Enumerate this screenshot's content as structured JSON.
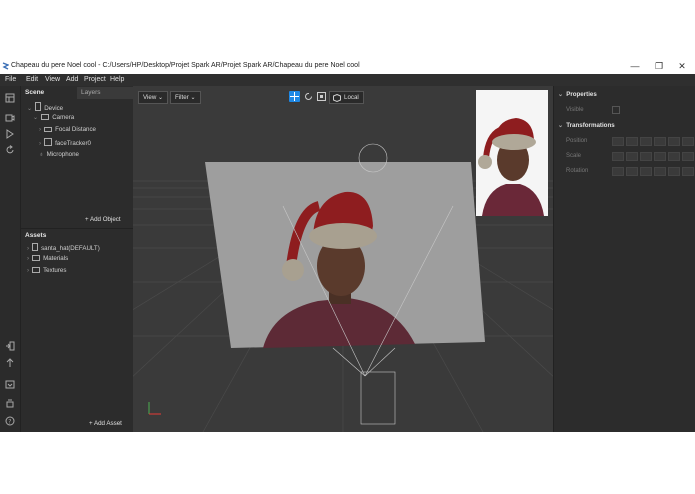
{
  "window": {
    "title": "Chapeau du pere Noel cool - C:/Users/HP/Desktop/Projet Spark AR/Projet Spark AR/Chapeau du pere Noel cool",
    "minimize": "—",
    "restore": "❐",
    "close": "✕"
  },
  "menu": [
    "File",
    "Edit",
    "View",
    "Add",
    "Project",
    "Help"
  ],
  "scene": {
    "tab_scene": "Scene",
    "tab_layers": "Layers",
    "items": [
      "Device",
      "Camera",
      "Focal Distance",
      "faceTracker0",
      "Microphone"
    ],
    "add_label": "+ Add Object"
  },
  "assets": {
    "header": "Assets",
    "items": [
      "santa_hat(DEFAULT)",
      "Materials",
      "Textures"
    ],
    "add_label": "+ Add Asset"
  },
  "viewport": {
    "view_label": "View ⌄",
    "filter_label": "Filter ⌄",
    "local_label": "Local"
  },
  "properties": {
    "header": "Properties",
    "visible_label": "Visible",
    "transformations_header": "Transformations",
    "position_label": "Position",
    "scale_label": "Scale",
    "rotation_label": "Rotation"
  },
  "colors": {
    "accent": "#1e88e5",
    "hat_red": "#8e1d1f",
    "fur": "#a8a090"
  }
}
